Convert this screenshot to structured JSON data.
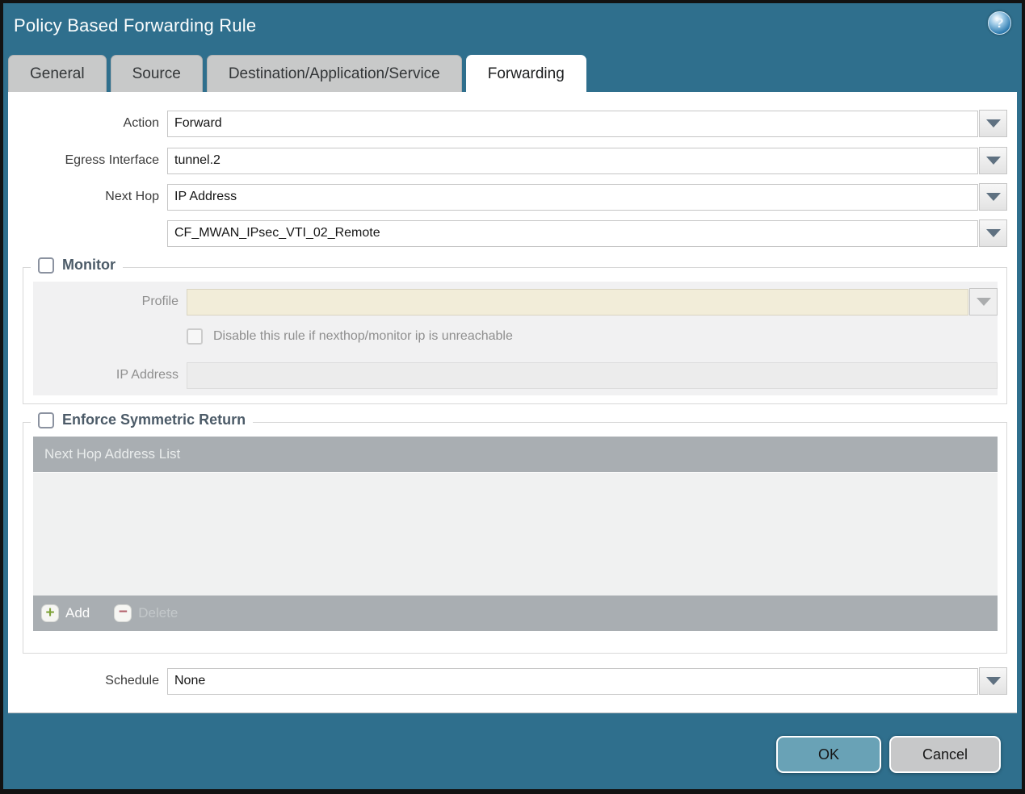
{
  "window": {
    "title": "Policy Based Forwarding Rule"
  },
  "icons": {
    "help_glyph": "?",
    "add_glyph": "+",
    "delete_glyph": "−"
  },
  "tabs": [
    {
      "label": "General",
      "active": false
    },
    {
      "label": "Source",
      "active": false
    },
    {
      "label": "Destination/Application/Service",
      "active": false
    },
    {
      "label": "Forwarding",
      "active": true
    }
  ],
  "form": {
    "action": {
      "label": "Action",
      "value": "Forward"
    },
    "egress_interface": {
      "label": "Egress Interface",
      "value": "tunnel.2"
    },
    "next_hop": {
      "label": "Next Hop",
      "value": "IP Address"
    },
    "next_hop_address": {
      "value": "CF_MWAN_IPsec_VTI_02_Remote"
    },
    "schedule": {
      "label": "Schedule",
      "value": "None"
    }
  },
  "monitor": {
    "legend": "Monitor",
    "checked": false,
    "profile": {
      "label": "Profile",
      "value": ""
    },
    "disable_rule": {
      "label": "Disable this rule if nexthop/monitor ip is unreachable",
      "checked": false
    },
    "ip_address": {
      "label": "IP Address",
      "value": ""
    }
  },
  "symmetric_return": {
    "legend": "Enforce Symmetric Return",
    "checked": false,
    "table": {
      "header": "Next Hop Address List",
      "rows": []
    },
    "add_label": "Add",
    "delete_label": "Delete"
  },
  "footer": {
    "ok_label": "OK",
    "cancel_label": "Cancel"
  },
  "colors": {
    "titlebar_teal": "#2f6f8d",
    "tab_inactive": "#c8c9c9",
    "legend_text": "#4c5b68",
    "disabled_field_beige": "#f2edd9",
    "disabled_field_gray": "#ececec",
    "table_chrome_gray": "#a9aeb2",
    "ok_button": "#69a2b6",
    "cancel_button": "#c7c8c9",
    "add_plus_green": "#7fa33a",
    "delete_minus_red": "#b2606b"
  }
}
